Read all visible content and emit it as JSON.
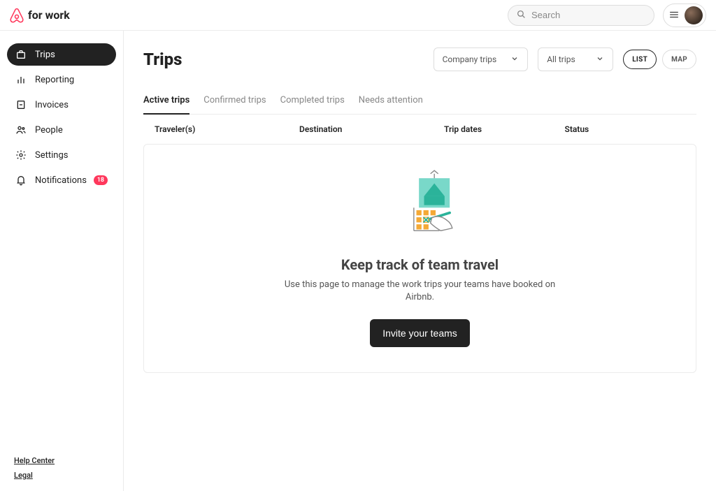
{
  "header": {
    "brand_text": "for work",
    "search_placeholder": "Search"
  },
  "sidebar": {
    "items": [
      {
        "label": "Trips",
        "active": true
      },
      {
        "label": "Reporting"
      },
      {
        "label": "Invoices"
      },
      {
        "label": "People"
      },
      {
        "label": "Settings"
      },
      {
        "label": "Notifications",
        "badge": "18"
      }
    ],
    "footer": {
      "help_center": "Help Center",
      "legal": "Legal"
    }
  },
  "page": {
    "title": "Trips",
    "filters": {
      "company_trips": "Company trips",
      "all_trips": "All trips"
    },
    "views": {
      "list": "LIST",
      "map": "MAP"
    },
    "tabs": [
      {
        "label": "Active trips",
        "active": true
      },
      {
        "label": "Confirmed trips"
      },
      {
        "label": "Completed trips"
      },
      {
        "label": "Needs attention"
      }
    ],
    "columns": {
      "travelers": "Traveler(s)",
      "destination": "Destination",
      "trip_dates": "Trip dates",
      "status": "Status"
    },
    "empty": {
      "title": "Keep track of team travel",
      "description": "Use this page to manage the work trips your teams have booked on Airbnb.",
      "button": "Invite your teams"
    }
  }
}
